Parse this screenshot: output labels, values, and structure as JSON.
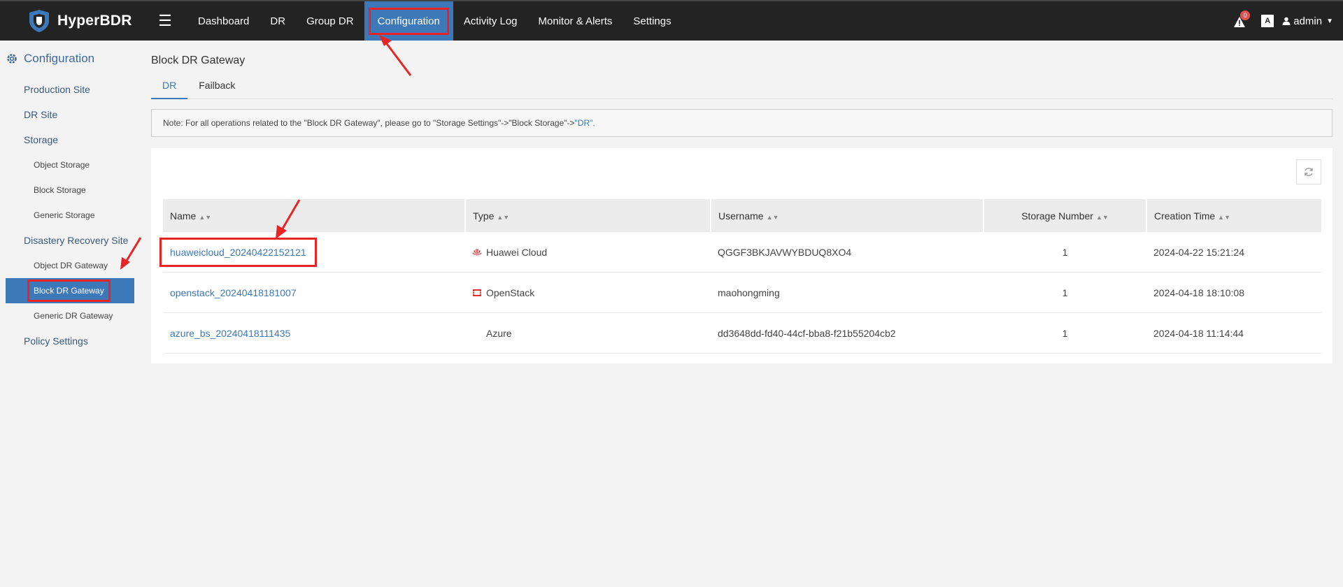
{
  "header": {
    "logo_text": "HyperBDR",
    "nav": [
      {
        "label": "Dashboard"
      },
      {
        "label": "DR"
      },
      {
        "label": "Group DR"
      },
      {
        "label": "Configuration"
      },
      {
        "label": "Activity Log"
      },
      {
        "label": "Monitor & Alerts"
      },
      {
        "label": "Settings"
      }
    ],
    "active_nav": "Configuration",
    "alert_count": "0",
    "lang_icon_text": "A",
    "user_name": "admin"
  },
  "sidebar": {
    "title": "Configuration",
    "items": [
      {
        "label": "Production Site",
        "level": 1
      },
      {
        "label": "DR Site",
        "level": 1
      },
      {
        "label": "Storage",
        "level": 1
      },
      {
        "label": "Object Storage",
        "level": 2
      },
      {
        "label": "Block Storage",
        "level": 2
      },
      {
        "label": "Generic Storage",
        "level": 2
      },
      {
        "label": "Disastery Recovery Site",
        "level": 1
      },
      {
        "label": "Object DR Gateway",
        "level": 2
      },
      {
        "label": "Block DR Gateway",
        "level": 2
      },
      {
        "label": "Generic DR Gateway",
        "level": 2
      },
      {
        "label": "Policy Settings",
        "level": 1
      }
    ],
    "active_item": "Block DR Gateway"
  },
  "main": {
    "title": "Block DR Gateway",
    "tabs": [
      {
        "label": "DR"
      },
      {
        "label": "Failback"
      }
    ],
    "active_tab": "DR",
    "note": {
      "text": "Note: For all operations related to the \"Block DR Gateway\", please go to \"Storage Settings\"->\"Block Storage\"->",
      "link": "\"DR\"."
    },
    "table": {
      "columns": [
        "Name",
        "Type",
        "Username",
        "Storage Number",
        "Creation Time"
      ],
      "rows": [
        {
          "name": "huaweicloud_20240422152121",
          "type": "Huawei Cloud",
          "type_icon": "huawei-cloud-icon",
          "username": "QGGF3BKJAVWYBDUQ8XO4",
          "storage_number": "1",
          "creation_time": "2024-04-22 15:21:24"
        },
        {
          "name": "openstack_20240418181007",
          "type": "OpenStack",
          "type_icon": "openstack-icon",
          "username": "maohongming",
          "storage_number": "1",
          "creation_time": "2024-04-18 18:10:08"
        },
        {
          "name": "azure_bs_20240418111435",
          "type": "Azure",
          "type_icon": "azure-icon",
          "username": "dd3648dd-fd40-44cf-bba8-f21b55204cb2",
          "storage_number": "1",
          "creation_time": "2024-04-18 11:14:44"
        }
      ]
    }
  },
  "colors": {
    "accent": "#3d78b8",
    "topbar": "#232323",
    "annotation": "#e82424"
  }
}
